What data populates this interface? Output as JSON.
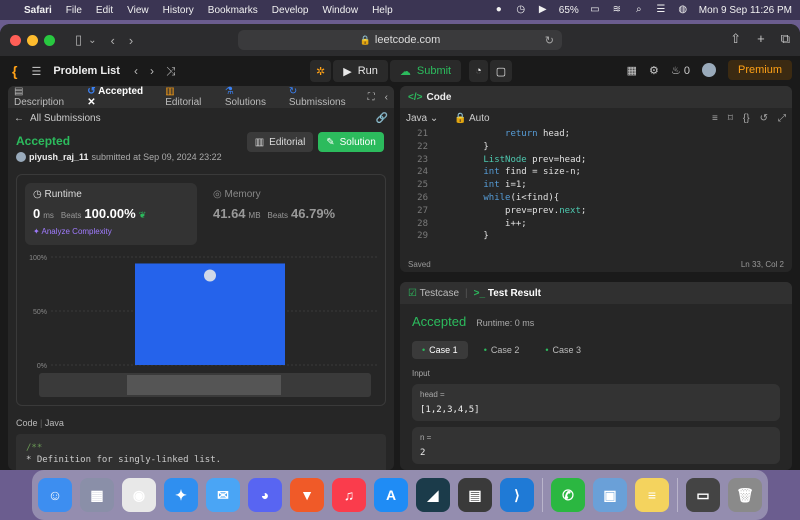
{
  "menubar": {
    "items": [
      "Safari",
      "File",
      "Edit",
      "View",
      "History",
      "Bookmarks",
      "Develop",
      "Window",
      "Help"
    ],
    "battery": "65%",
    "clock": "Mon 9 Sep  11:26 PM"
  },
  "safari": {
    "url": "leetcode.com"
  },
  "lcnav": {
    "problem_list": "Problem List",
    "run": "Run",
    "submit": "Submit",
    "streak": "0",
    "premium": "Premium"
  },
  "left": {
    "tabs": [
      "Description",
      "Accepted",
      "Editorial",
      "Solutions",
      "Submissions"
    ],
    "all_submissions": "All Submissions",
    "status": "Accepted",
    "user": "piyush_raj_11",
    "submitted": "submitted at Sep 09, 2024 23:22",
    "editorial_btn": "Editorial",
    "solution_btn": "Solution",
    "runtime_label": "Runtime",
    "runtime_value": "0",
    "runtime_unit": "ms",
    "beats_label": "Beats",
    "runtime_beats": "100.00%",
    "analyze": "Analyze Complexity",
    "memory_label": "Memory",
    "memory_value": "41.64",
    "memory_unit": "MB",
    "memory_beats": "46.79%",
    "code_header": "Code",
    "code_lang": "Java",
    "code_preview": [
      "/**",
      " * Definition for singly-linked list."
    ]
  },
  "chart_data": {
    "type": "bar",
    "yticks": [
      "100%",
      "50%",
      "0%"
    ],
    "ylim": [
      0,
      100
    ],
    "categories": [
      "0 ms"
    ],
    "values": [
      94
    ]
  },
  "code_panel": {
    "title": "Code",
    "lang": "Java",
    "mode": "Auto",
    "lines": [
      {
        "n": "21",
        "indent": "            ",
        "parts": [
          [
            "kw",
            "return"
          ],
          [
            "tx",
            " head;"
          ]
        ]
      },
      {
        "n": "22",
        "indent": "        ",
        "parts": [
          [
            "tx",
            "}"
          ]
        ]
      },
      {
        "n": "23",
        "indent": "        ",
        "parts": [
          [
            "ty",
            "ListNode"
          ],
          [
            "tx",
            " prev=head;"
          ]
        ]
      },
      {
        "n": "24",
        "indent": "        ",
        "parts": [
          [
            "kw",
            "int"
          ],
          [
            "tx",
            " find = size-n;"
          ]
        ]
      },
      {
        "n": "25",
        "indent": "        ",
        "parts": [
          [
            "kw",
            "int"
          ],
          [
            "tx",
            " i=1;"
          ]
        ]
      },
      {
        "n": "26",
        "indent": "        ",
        "parts": [
          [
            "kw",
            "while"
          ],
          [
            "tx",
            "(i<find){"
          ]
        ]
      },
      {
        "n": "27",
        "indent": "            ",
        "parts": [
          [
            "tx",
            "prev=prev."
          ],
          [
            "ty",
            "next"
          ],
          [
            "tx",
            ";"
          ]
        ]
      },
      {
        "n": "28",
        "indent": "            ",
        "parts": [
          [
            "tx",
            "i++;"
          ]
        ]
      },
      {
        "n": "29",
        "indent": "        ",
        "parts": [
          [
            "tx",
            "}"
          ]
        ]
      }
    ],
    "saved": "Saved",
    "position": "Ln 33, Col 2"
  },
  "result": {
    "tab_testcase": "Testcase",
    "tab_result": "Test Result",
    "status": "Accepted",
    "runtime": "Runtime: 0 ms",
    "cases": [
      "Case 1",
      "Case 2",
      "Case 3"
    ],
    "input_label": "Input",
    "inputs": [
      {
        "key": "head =",
        "value": "[1,2,3,4,5]"
      },
      {
        "key": "n =",
        "value": "2"
      }
    ]
  },
  "dock": {
    "apps": [
      {
        "name": "finder",
        "color": "#3d8ef0",
        "glyph": "☺"
      },
      {
        "name": "launchpad",
        "color": "#8a8fa8",
        "glyph": "▦"
      },
      {
        "name": "chrome",
        "color": "#e8e8e8",
        "glyph": "◉"
      },
      {
        "name": "safari",
        "color": "#2f8ff0",
        "glyph": "✦"
      },
      {
        "name": "mail",
        "color": "#4aa5f5",
        "glyph": "✉"
      },
      {
        "name": "discord",
        "color": "#5865f2",
        "glyph": "◕"
      },
      {
        "name": "brave",
        "color": "#f05a28",
        "glyph": "▼"
      },
      {
        "name": "music",
        "color": "#fa3c4c",
        "glyph": "♫"
      },
      {
        "name": "app-store",
        "color": "#1f8cf5",
        "glyph": "A"
      },
      {
        "name": "terminal-app",
        "color": "#1b3b4a",
        "glyph": "◢"
      },
      {
        "name": "calculator",
        "color": "#3a3a3a",
        "glyph": "▤"
      },
      {
        "name": "vscode",
        "color": "#1f7ad6",
        "glyph": "⟩"
      },
      {
        "name": "whatsapp",
        "color": "#2bb741",
        "glyph": "✆"
      },
      {
        "name": "preview",
        "color": "#6aa0d8",
        "glyph": "▣"
      },
      {
        "name": "notes",
        "color": "#f4d35e",
        "glyph": "≡"
      },
      {
        "name": "screenshot",
        "color": "#444",
        "glyph": "▭"
      },
      {
        "name": "trash",
        "color": "#8a8a8a",
        "glyph": "🗑"
      }
    ]
  }
}
